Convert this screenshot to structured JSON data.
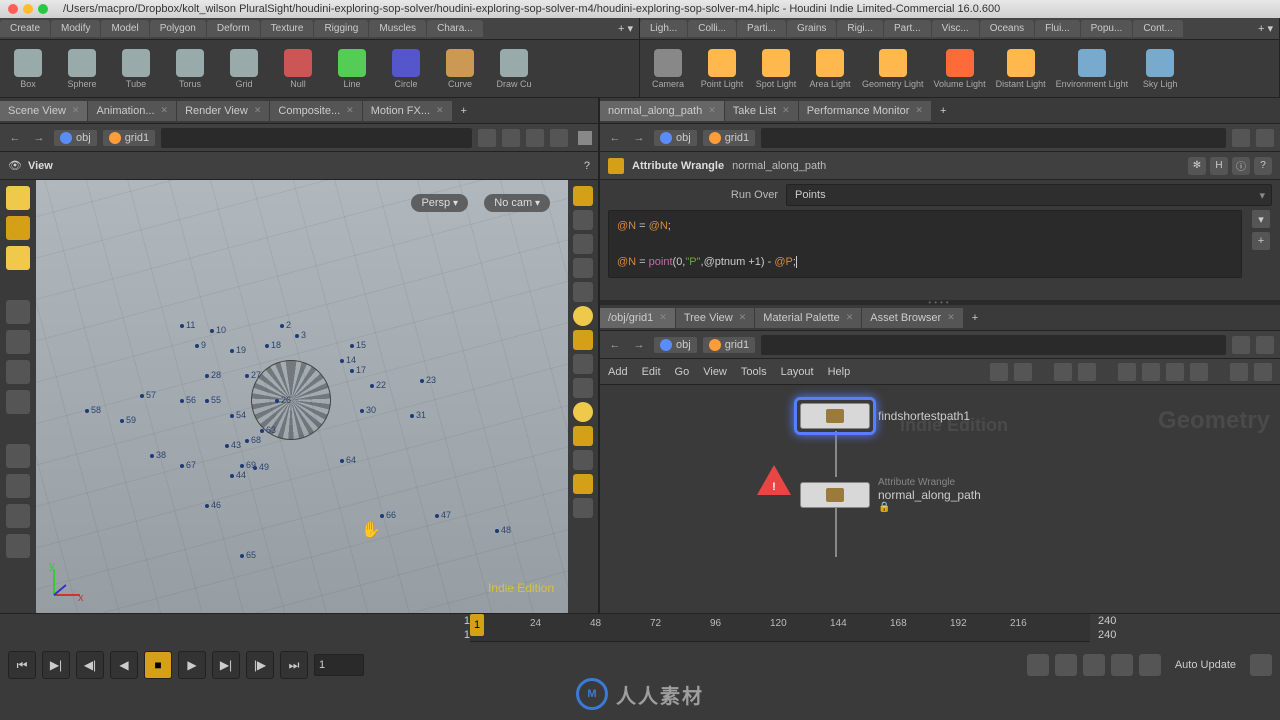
{
  "window": {
    "title_path": "/Users/macpro/Dropbox/kolt_wilson PluralSight/houdini-exploring-sop-solver/houdini-exploring-sop-solver-m4/houdini-exploring-sop-solver-m4.hiplc - Houdini Indie Limited-Commercial 16.0.600"
  },
  "shelf_left": {
    "tabs": [
      "Create",
      "Modify",
      "Model",
      "Polygon",
      "Deform",
      "Texture",
      "Rigging",
      "Muscles",
      "Chara..."
    ],
    "tools": [
      "Box",
      "Sphere",
      "Tube",
      "Torus",
      "Grid",
      "Null",
      "Line",
      "Circle",
      "Curve",
      "Draw Cu"
    ]
  },
  "shelf_right": {
    "tabs": [
      "Ligh...",
      "Colli...",
      "Parti...",
      "Grains",
      "Rigi...",
      "Part...",
      "Visc...",
      "Oceans",
      "Flui...",
      "Popu...",
      "Cont..."
    ],
    "tools": [
      "Camera",
      "Point Light",
      "Spot Light",
      "Area Light",
      "Geometry Light",
      "Volume Light",
      "Distant Light",
      "Environment Light",
      "Sky Ligh"
    ]
  },
  "left_tabs": [
    "Scene View",
    "Animation...",
    "Render View",
    "Composite...",
    "Motion FX..."
  ],
  "left_path": {
    "seg1": "obj",
    "seg2": "grid1"
  },
  "view": {
    "label": "View",
    "persp": "Persp",
    "camera": "No cam",
    "edition": "Indie Edition",
    "point_labels": [
      "11",
      "10",
      "9",
      "19",
      "18",
      "2",
      "3",
      "15",
      "17",
      "28",
      "27",
      "14",
      "23",
      "22",
      "57",
      "56",
      "55",
      "54",
      "26",
      "30",
      "31",
      "58",
      "59",
      "38",
      "43",
      "68",
      "63",
      "69",
      "67",
      "44",
      "64",
      "46",
      "65",
      "66",
      "47",
      "48",
      "49"
    ]
  },
  "right_top_tabs": [
    "normal_along_path",
    "Take List",
    "Performance Monitor"
  ],
  "right_path": {
    "seg1": "obj",
    "seg2": "grid1"
  },
  "parm": {
    "node_type": "Attribute Wrangle",
    "node_name": "normal_along_path",
    "run_over_label": "Run Over",
    "run_over_value": "Points",
    "code_line1_a": "@N",
    "code_line1_b": " = ",
    "code_line1_c": "@N",
    "code_line1_d": ";",
    "code_line2_a": "@N",
    "code_line2_b": " = ",
    "code_line2_fn": "point",
    "code_line2_c": "(0,",
    "code_line2_str": "\"P\"",
    "code_line2_d": ",@ptnum +1) - ",
    "code_line2_e": "@P",
    "code_line2_f": ";"
  },
  "right_bot_tabs": [
    "/obj/grid1",
    "Tree View",
    "Material Palette",
    "Asset Browser"
  ],
  "net_path": {
    "seg1": "obj",
    "seg2": "grid1"
  },
  "net_menu": [
    "Add",
    "Edit",
    "Go",
    "View",
    "Tools",
    "Layout",
    "Help"
  ],
  "network": {
    "geom_label": "Geometry",
    "indie_banner": "Indie Edition",
    "node1_label": "findshortestpath1",
    "node2_type": "Attribute Wrangle",
    "node2_label": "normal_along_path",
    "warn_glyph": "!"
  },
  "timeline": {
    "ticks": [
      "24",
      "48",
      "72",
      "96",
      "120",
      "144",
      "168",
      "192",
      "216"
    ],
    "marker": "1",
    "current": "1",
    "start": "1",
    "end": "1",
    "range_start": "240",
    "range_end": "240",
    "auto_update": "Auto Update"
  },
  "watermark": {
    "logo": "M",
    "text": "人人素材"
  }
}
